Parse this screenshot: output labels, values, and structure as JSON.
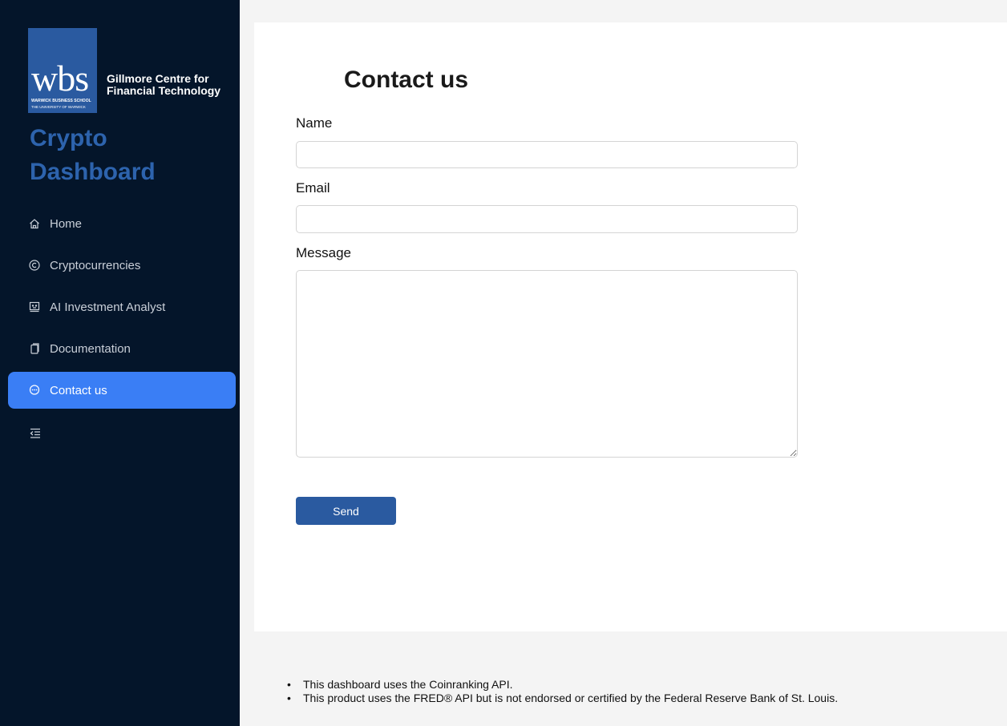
{
  "brand": {
    "logo_text": "wbs",
    "logo_sub1": "WARWICK BUSINESS SCHOOL",
    "logo_sub2": "THE UNIVERSITY OF WARWICK",
    "centre_line1": "Gillmore Centre for",
    "centre_line2": "Financial Technology",
    "logo_color": "#2a5aa0"
  },
  "app": {
    "title_line1": "Crypto",
    "title_line2": "Dashboard",
    "title_color": "#2d63ad"
  },
  "sidebar": {
    "items": [
      {
        "label": "Home",
        "icon": "home-icon",
        "active": false
      },
      {
        "label": "Cryptocurrencies",
        "icon": "copyright-circle-icon",
        "active": false
      },
      {
        "label": "AI Investment Analyst",
        "icon": "robot-icon",
        "active": false
      },
      {
        "label": "Documentation",
        "icon": "document-icon",
        "active": false
      },
      {
        "label": "Contact us",
        "icon": "chat-bubble-icon",
        "active": true
      }
    ],
    "collapse_icon": "menu-collapse-icon",
    "bg_color": "#04152a",
    "active_color": "#3a7ef5"
  },
  "main": {
    "title": "Contact us",
    "form": {
      "name_label": "Name",
      "name_value": "",
      "email_label": "Email",
      "email_value": "",
      "message_label": "Message",
      "message_value": "",
      "send_label": "Send"
    }
  },
  "footer": {
    "notes": [
      "This dashboard uses the Coinranking API.",
      "This product uses the FRED® API but is not endorsed or certified by the Federal Reserve Bank of St. Louis."
    ]
  }
}
